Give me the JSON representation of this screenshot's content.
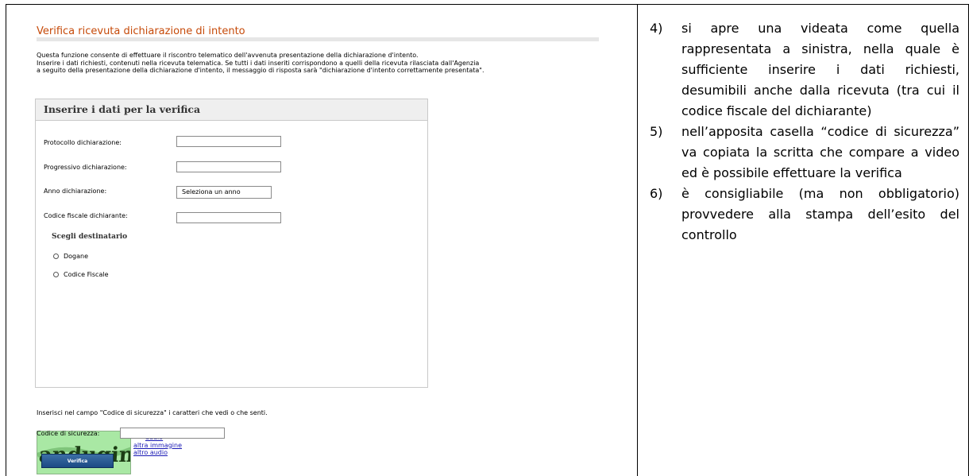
{
  "screenshot": {
    "title": "Verifica ricevuta dichiarazione di intento",
    "intro_lines": [
      "Questa funzione consente di effettuare il riscontro telematico dell'avvenuta presentazione della dichiarazione d'intento.",
      "Inserire i dati richiesti, contenuti nella ricevuta telematica. Se tutti i dati inseriti corrispondono a quelli della ricevuta rilasciata dall'Agenzia",
      "a seguito della presentazione della dichiarazione d'intento, il messaggio di risposta sarà \"dichiarazione d'intento correttamente presentata\"."
    ],
    "form": {
      "header": "Inserire i dati per la verifica",
      "protocollo_label": "Protocollo dichiarazione:",
      "protocollo_value": "",
      "progressivo_label": "Progressivo dichiarazione:",
      "progressivo_value": "",
      "anno_label": "Anno dichiarazione:",
      "anno_selected": "Seleziona un anno",
      "codice_fiscale_label": "Codice fiscale dichiarante:",
      "codice_fiscale_value": "",
      "destinatario_heading": "Scegli destinatario",
      "radio_dogane": "Dogane",
      "radio_codice_fiscale": "Codice Fiscale"
    },
    "security": {
      "instruction": "Inserisci nel campo \"Codice di sicurezza\" i caratteri che vedi o che senti.",
      "captcha_text": "andugini",
      "audio_link": "audio",
      "other_image_link": "altra immagine",
      "other_audio_link": "altro audio",
      "code_label": "Codice di sicurezza:",
      "code_value": "",
      "verify_button": "Verifica"
    }
  },
  "steps": [
    {
      "num": "4)",
      "text": "si apre una videata come quella rappresentata a sinistra, nella quale è sufficiente inserire i dati richiesti, desumibili anche dalla ricevuta (tra cui il codice fiscale del dichiarante)"
    },
    {
      "num": "5)",
      "text": "nell’apposita casella “codice di sicurezza” va copiata la scritta che compare a video ed è possibile effettuare la verifica"
    },
    {
      "num": "6)",
      "text": "è consigliabile (ma non obbligatorio) provvedere alla stampa dell’esito del controllo"
    }
  ]
}
